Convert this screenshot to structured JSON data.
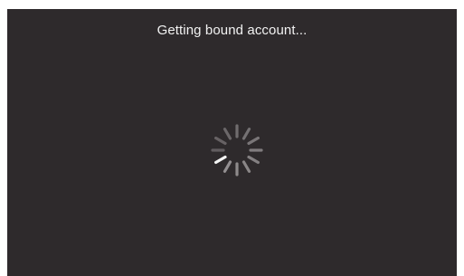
{
  "dialog": {
    "status_text": "Getting bound account...",
    "spinner_icon": "loading-spinner-icon"
  },
  "colors": {
    "background": "#2e2a2c",
    "text": "#f2f2f2",
    "spinner_bright": "#f4f4f4",
    "spinner_dim": "#9a9698"
  }
}
